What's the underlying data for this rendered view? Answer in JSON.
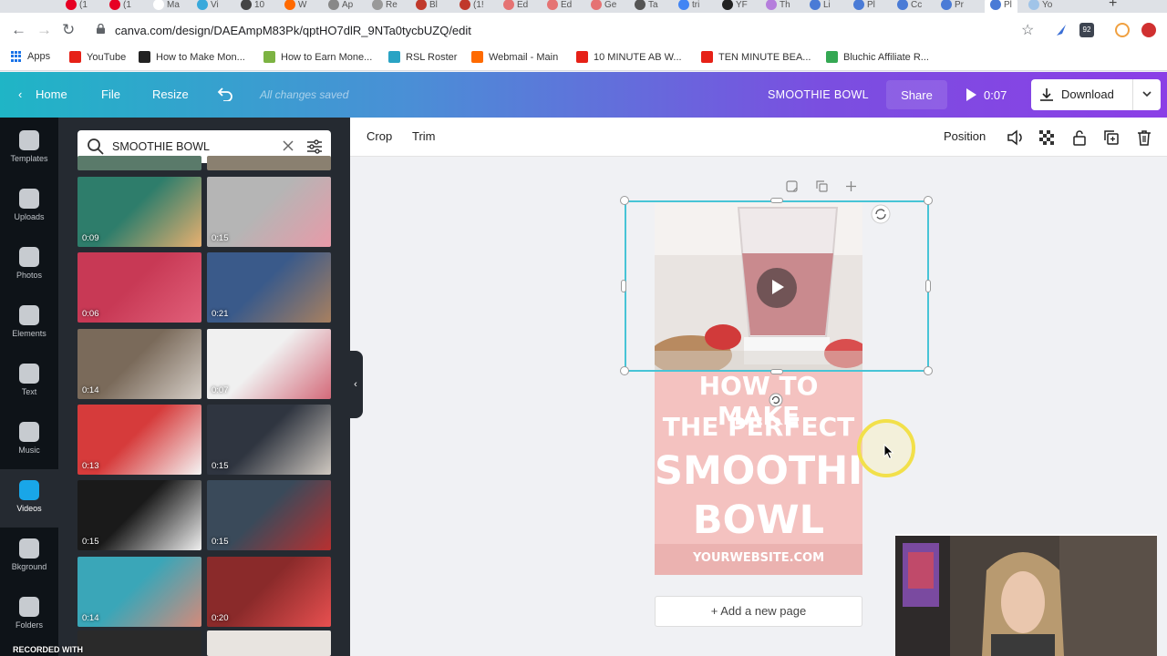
{
  "browser": {
    "tabs": [
      {
        "label": "(1",
        "color": "#e60023"
      },
      {
        "label": "(1",
        "color": "#e60023"
      },
      {
        "label": "Ma",
        "color": "#ffffff"
      },
      {
        "label": "Vi",
        "color": "#39a9db"
      },
      {
        "label": "10",
        "color": "#444444"
      },
      {
        "label": "W",
        "color": "#ff6a00"
      },
      {
        "label": "Ap",
        "color": "#888888"
      },
      {
        "label": "Re",
        "color": "#999999"
      },
      {
        "label": "Bl",
        "color": "#c0392b"
      },
      {
        "label": "(1!",
        "color": "#c0392b"
      },
      {
        "label": "Ed",
        "color": "#e57373"
      },
      {
        "label": "Ed",
        "color": "#e57373"
      },
      {
        "label": "Ge",
        "color": "#e57373"
      },
      {
        "label": "Ta",
        "color": "#555555"
      },
      {
        "label": "tri",
        "color": "#4285f4"
      },
      {
        "label": "YF",
        "color": "#222222"
      },
      {
        "label": "Th",
        "color": "#b57edc"
      },
      {
        "label": "Li",
        "color": "#4a7bd6"
      },
      {
        "label": "Pl",
        "color": "#4a7bd6"
      },
      {
        "label": "Cc",
        "color": "#4a7bd6"
      },
      {
        "label": "Pr",
        "color": "#4a7bd6"
      },
      {
        "label": "Pl",
        "color": "#4a7bd6"
      },
      {
        "label": "Yo",
        "color": "#a0c4e8"
      }
    ],
    "url": "canva.com/design/DAEAmpM83Pk/qptHO7dlR_9NTa0tycbUZQ/edit",
    "extension_badge": "92",
    "bookmarks": [
      {
        "label": "Apps",
        "icon": "apps-grid-icon",
        "color": "#1a73e8"
      },
      {
        "label": "YouTube",
        "icon": "youtube-icon",
        "color": "#e62117"
      },
      {
        "label": "How to Make Mon...",
        "icon": "sb-icon",
        "color": "#222222"
      },
      {
        "label": "How to Earn Mone...",
        "icon": "diamond-icon",
        "color": "#7cb342"
      },
      {
        "label": "RSL Roster",
        "icon": "person-icon",
        "color": "#29a3c4"
      },
      {
        "label": "Webmail - Main",
        "icon": "webmail-icon",
        "color": "#ff6a00"
      },
      {
        "label": "10 MINUTE AB W...",
        "icon": "youtube-icon",
        "color": "#e62117"
      },
      {
        "label": "TEN MINUTE BEA...",
        "icon": "youtube-icon",
        "color": "#e62117"
      },
      {
        "label": "Bluchic Affiliate R...",
        "icon": "drive-icon",
        "color": "#34a853"
      }
    ]
  },
  "header": {
    "home": "Home",
    "file": "File",
    "resize": "Resize",
    "saved_status": "All changes saved",
    "design_title": "SMOOTHIE BOWL",
    "share": "Share",
    "duration": "0:07",
    "download": "Download"
  },
  "rail": {
    "items": [
      {
        "label": "Templates",
        "icon": "templates-icon"
      },
      {
        "label": "Uploads",
        "icon": "cloud-upload-icon"
      },
      {
        "label": "Photos",
        "icon": "photo-icon"
      },
      {
        "label": "Elements",
        "icon": "shapes-icon"
      },
      {
        "label": "Text",
        "icon": "text-t-icon"
      },
      {
        "label": "Music",
        "icon": "music-note-icon"
      },
      {
        "label": "Videos",
        "icon": "video-play-icon"
      },
      {
        "label": "Bkground",
        "icon": "background-pattern-icon"
      },
      {
        "label": "Folders",
        "icon": "folder-icon"
      }
    ],
    "active": "Videos"
  },
  "panel": {
    "search_value": "SMOOTHIE BOWL",
    "videos": [
      {
        "duration": "0:09",
        "c1": "#2e7d6b",
        "c2": "#e8b070"
      },
      {
        "duration": "0:15",
        "c1": "#b5b5b5",
        "c2": "#e89aa8"
      },
      {
        "duration": "0:06",
        "c1": "#c83955",
        "c2": "#e1607a"
      },
      {
        "duration": "0:21",
        "c1": "#3a5a8a",
        "c2": "#a88060"
      },
      {
        "duration": "0:14",
        "c1": "#7a6a5a",
        "c2": "#d6cfc8"
      },
      {
        "duration": "0:07",
        "c1": "#f0f0f0",
        "c2": "#d46a7a"
      },
      {
        "duration": "0:13",
        "c1": "#d63b3b",
        "c2": "#f5f5f5"
      },
      {
        "duration": "0:15",
        "c1": "#2f3540",
        "c2": "#cfc8c0"
      },
      {
        "duration": "0:15",
        "c1": "#1a1a1a",
        "c2": "#f0f0f0"
      },
      {
        "duration": "0:15",
        "c1": "#3a4a5a",
        "c2": "#b83030"
      },
      {
        "duration": "0:14",
        "c1": "#3aa6b8",
        "c2": "#d48a7a"
      },
      {
        "duration": "0:20",
        "c1": "#8a2a2a",
        "c2": "#e85050"
      }
    ],
    "recording_watermark": "RECORDED WITH"
  },
  "toolbar": {
    "crop": "Crop",
    "trim": "Trim",
    "position": "Position"
  },
  "design": {
    "line1": "HOW TO MAKE",
    "line2": "THE PERFECT",
    "line3": "SMOOTHIE",
    "line4": "BOWL",
    "website": "YOURWEBSITE.COM",
    "background_color": "#f4c2c0"
  },
  "canvas": {
    "add_page": "+ Add a new page"
  }
}
